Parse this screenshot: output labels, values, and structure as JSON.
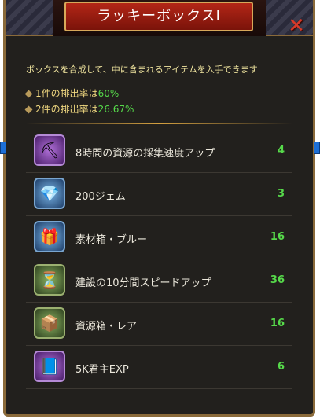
{
  "title": "ラッキーボックスI",
  "description": "ボックスを合成して、中に含まれるアイテムを入手できます",
  "rates": [
    {
      "prefix": "1件の排出率は",
      "value": "60%"
    },
    {
      "prefix": "2件の排出率は",
      "value": "26.67%"
    }
  ],
  "items": [
    {
      "label": "8時間の資源の採集速度アップ",
      "count": "4",
      "icon": "resource-speed-icon",
      "glyph": "⛏"
    },
    {
      "label": "200ジェム",
      "count": "3",
      "icon": "gems-icon",
      "glyph": "💎"
    },
    {
      "label": "素材箱・ブルー",
      "count": "16",
      "icon": "material-box-icon",
      "glyph": "🎁"
    },
    {
      "label": "建設の10分間スピードアップ",
      "count": "36",
      "icon": "hourglass-icon",
      "glyph": "⏳"
    },
    {
      "label": "資源箱・レア",
      "count": "16",
      "icon": "resource-box-icon",
      "glyph": "📦"
    },
    {
      "label": "5K君主EXP",
      "count": "6",
      "icon": "exp-book-icon",
      "glyph": "📘"
    }
  ],
  "colors": {
    "accent_green": "#56d94a",
    "title_red": "#b32617",
    "gold": "#d4a040"
  }
}
